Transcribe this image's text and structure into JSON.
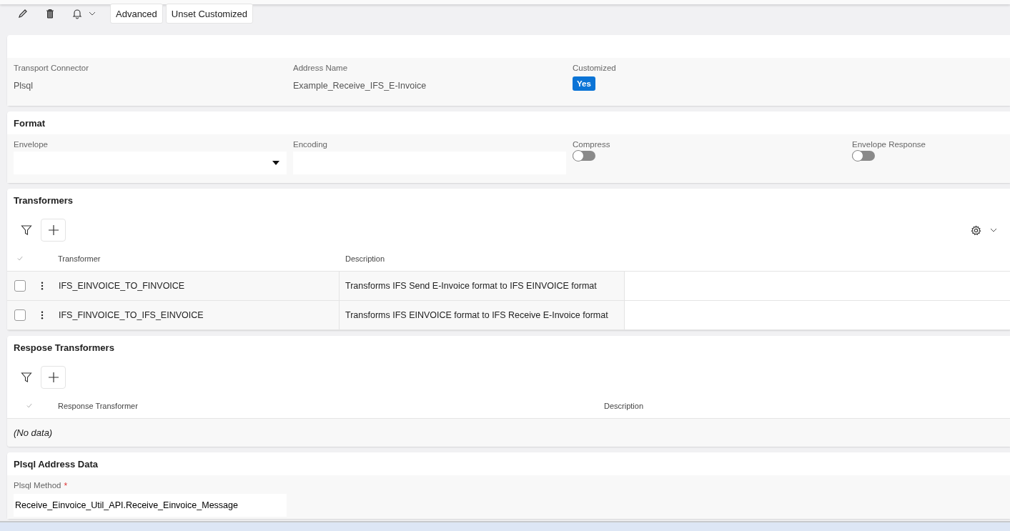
{
  "toolbar": {
    "buttons": [
      "Advanced",
      "Unset Customized"
    ]
  },
  "header": {
    "fields": [
      {
        "kind": "text",
        "label": "Transport Connector",
        "value": "Plsql"
      },
      {
        "kind": "text",
        "label": "Address Name",
        "value": "Example_Receive_IFS_E-Invoice"
      },
      {
        "kind": "badge",
        "label": "Customized",
        "value": "Yes"
      }
    ]
  },
  "format": {
    "title": "Format",
    "fields": [
      {
        "kind": "dropdown",
        "label": "Envelope"
      },
      {
        "kind": "input",
        "label": "Encoding"
      },
      {
        "kind": "toggle",
        "label": "Compress",
        "on": false
      },
      {
        "kind": "toggle",
        "label": "Envelope Response",
        "on": false
      }
    ]
  },
  "transformers": {
    "title": "Transformers",
    "columns": [
      "Transformer",
      "Description"
    ],
    "rows": [
      {
        "checked": false,
        "transformer": "IFS_EINVOICE_TO_FINVOICE",
        "description": "Transforms IFS Send E-Invoice format to IFS EINVOICE format"
      },
      {
        "checked": false,
        "transformer": "IFS_FINVOICE_TO_IFS_EINVOICE",
        "description": "Transforms IFS EINVOICE format to IFS Receive E-Invoice format"
      }
    ]
  },
  "response_transformers": {
    "title": "Respose Transformers",
    "columns": [
      "Response Transformer",
      "Description"
    ],
    "empty_text": "(No data)"
  },
  "plsql_address_data": {
    "title": "Plsql Address Data",
    "field": {
      "label": "Plsql Method",
      "required_mark": "*",
      "value": "Receive_Einvoice_Util_API.Receive_Einvoice_Message"
    }
  }
}
